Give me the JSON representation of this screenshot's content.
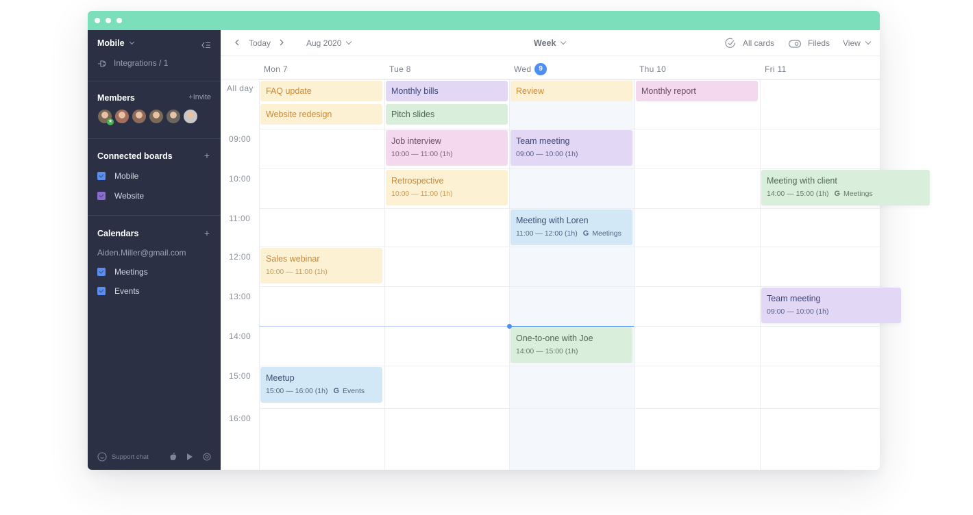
{
  "window": {
    "accent_color": "#7adfba"
  },
  "sidebar": {
    "workspace": "Mobile",
    "integrations": "Integrations / 1",
    "members": {
      "title": "Members",
      "invite_label": "+Invite",
      "avatars": [
        {
          "name": "member-1",
          "color": "#7a6a55",
          "badge": "★"
        },
        {
          "name": "member-2",
          "color": "#a36f5c"
        },
        {
          "name": "member-3",
          "color": "#8e6b58"
        },
        {
          "name": "member-4",
          "color": "#7a6a55"
        },
        {
          "name": "member-5",
          "color": "#6a6560"
        },
        {
          "name": "member-6",
          "color": "#c9c8c8"
        }
      ]
    },
    "connected_boards": {
      "title": "Connected boards",
      "add_label": "+",
      "items": [
        {
          "label": "Mobile",
          "checked": true,
          "color": "#5b8ef0"
        },
        {
          "label": "Website",
          "checked": true,
          "color": "#8a6cd1"
        }
      ]
    },
    "calendars": {
      "title": "Calendars",
      "add_label": "+",
      "account": "Aiden.Miller@gmail.com",
      "items": [
        {
          "label": "Meetings",
          "checked": true,
          "color": "#5b8ef0"
        },
        {
          "label": "Events",
          "checked": true,
          "color": "#5b8ef0"
        }
      ]
    },
    "footer": {
      "support_label": "Support chat"
    }
  },
  "toolbar": {
    "today_label": "Today",
    "month_label": "Aug 2020",
    "view_mode": "Week",
    "all_cards_label": "All cards",
    "fields_label": "Fileds",
    "view_label": "View"
  },
  "calendar": {
    "days": [
      {
        "label": "Mon 7"
      },
      {
        "label": "Tue 8"
      },
      {
        "label": "Wed",
        "badge": "9",
        "today": true
      },
      {
        "label": "Thu 10"
      },
      {
        "label": "Fri 11"
      }
    ],
    "allday_label": "All day",
    "hours": [
      "09:00",
      "10:00",
      "11:00",
      "12:00",
      "13:00",
      "14:00",
      "15:00",
      "16:00"
    ],
    "allday_events": [
      {
        "day": 0,
        "slot": 0,
        "title": "FAQ update",
        "color": "yellow"
      },
      {
        "day": 0,
        "slot": 1,
        "title": "Website redesign",
        "color": "yellow"
      },
      {
        "day": 1,
        "slot": 0,
        "title": "Monthly bills",
        "color": "purple"
      },
      {
        "day": 1,
        "slot": 1,
        "title": "Pitch slides",
        "color": "green"
      },
      {
        "day": 2,
        "slot": 0,
        "title": "Review",
        "color": "yellow"
      },
      {
        "day": 3,
        "slot": 0,
        "title": "Monthly report",
        "color": "pink"
      }
    ],
    "events": [
      {
        "day": 1,
        "row": 0,
        "title": "Job interview",
        "time": "10:00 — 11:00 (1h)",
        "color": "pink"
      },
      {
        "day": 2,
        "row": 0,
        "title": "Team meeting",
        "time": "09:00 — 10:00 (1h)",
        "color": "purple"
      },
      {
        "day": 1,
        "row": 1,
        "title": "Retrospective",
        "time": "10:00 — 11:00 (1h)",
        "color": "yellow"
      },
      {
        "day": 4,
        "row": 1,
        "title": "Meeting with client",
        "time": "14:00 — 15:00 (1h)",
        "calendar": "Meetings",
        "color": "green",
        "dragging": true
      },
      {
        "day": 2,
        "row": 2,
        "title": "Meeting with Loren",
        "time": "11:00 — 12:00 (1h)",
        "calendar": "Meetings",
        "color": "blue"
      },
      {
        "day": 0,
        "row": 3,
        "title": "Sales webinar",
        "time": "10:00 — 11:00 (1h)",
        "color": "yellow"
      },
      {
        "day": 4,
        "row": 4,
        "title": "Team meeting",
        "time": "09:00 — 10:00 (1h)",
        "color": "purple",
        "dragging": true
      },
      {
        "day": 2,
        "row": 5,
        "title": "One-to-one with Joe",
        "time": "14:00 — 15:00 (1h)",
        "color": "green"
      },
      {
        "day": 0,
        "row": 6,
        "title": "Meetup",
        "time": "15:00 — 16:00 (1h)",
        "calendar": "Events",
        "color": "blue"
      }
    ],
    "current_time": "13:30"
  }
}
